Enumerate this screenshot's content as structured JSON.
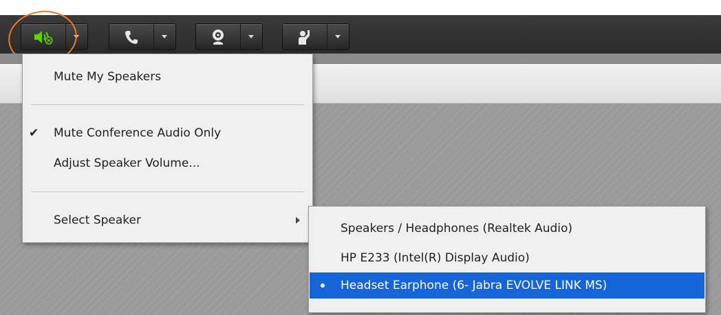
{
  "toolbar": {
    "groups": [
      {
        "name": "speaker",
        "icon": "speaker-icon",
        "active": true,
        "accent": "#5fd000"
      },
      {
        "name": "phone",
        "icon": "phone-icon"
      },
      {
        "name": "webcam",
        "icon": "webcam-icon"
      },
      {
        "name": "raise-hand",
        "icon": "raise-hand-icon"
      }
    ],
    "highlight_color": "#f07a2a"
  },
  "speaker_menu": {
    "items": {
      "mute_speakers": {
        "label": "Mute My Speakers"
      },
      "mute_conference": {
        "label": "Mute Conference Audio Only",
        "checked": true,
        "check_glyph": "✔"
      },
      "adjust_volume": {
        "label": "Adjust Speaker Volume..."
      },
      "select_speaker": {
        "label": "Select Speaker",
        "has_submenu": true
      }
    }
  },
  "speaker_submenu": {
    "items": [
      {
        "label": "Speakers / Headphones (Realtek Audio)",
        "selected": false
      },
      {
        "label": "HP E233 (Intel(R) Display Audio)",
        "selected": false
      },
      {
        "label": "Headset Earphone (6- Jabra EVOLVE LINK MS)",
        "selected": true
      }
    ],
    "selection_color": "#1565d8"
  }
}
